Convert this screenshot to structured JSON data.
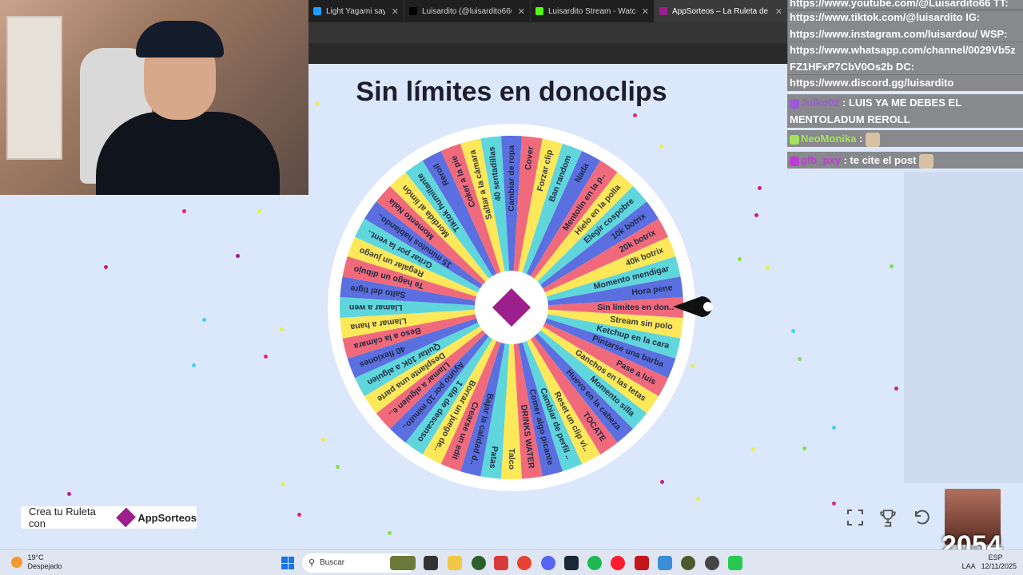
{
  "tabs": [
    {
      "label": "Light Yagami saying",
      "fav": "#1e9fff",
      "active": false
    },
    {
      "label": "Luisardito (@luisardito666) / X",
      "fav": "#000000",
      "active": false
    },
    {
      "label": "Luisardito Stream - Watch Live",
      "fav": "#53fc18",
      "active": false
    },
    {
      "label": "AppSorteos – La Ruleta de",
      "fav": "#9c1f8d",
      "active": true
    }
  ],
  "page": {
    "title": "Sin límites en donoclips",
    "brand_prefix": "Crea tu Ruleta con",
    "brand_name": "AppSorteos"
  },
  "wheel": {
    "colors": [
      "#f06a7c",
      "#fde85a",
      "#5fd6dc",
      "#5b6fe0"
    ],
    "segments": [
      "Sin límites en don..",
      "Stream sin polo",
      "Ketchup en la cara",
      "Pintarse una barba",
      "Pase a luis",
      "Ganchos en las tetas",
      "Momento silla",
      "Huevo en la cabeza",
      "TOCATE",
      "Reset un clip vi..",
      "Cambiar de perfil ..",
      "Comer algo picante",
      "DRINKS WATER",
      "Talco",
      "Patas",
      "Bajar la calidad d..",
      "Crearse un edit",
      "Borrar un juego de..",
      "1 día de descanso",
      "Ayuno por 10 minuto..",
      "Llamar a alguien e..",
      "Desplante una parte",
      "Quitar 10K a alguien",
      "40 flexiones",
      "Beso a la cámara",
      "Llamar a hana",
      "Llamar a wen",
      "Salto del tigre",
      "Te hago un dibujo",
      "Regalar un juego",
      "Gritar por la vent..",
      "15 minutos hablando..",
      "Momento Nala",
      "Mordida al limón",
      "Tiktok humillante",
      "Reroll",
      "Coker a la pie",
      "Saltar a la cámara",
      "40 sentadillas",
      "Cambiar de ropa",
      "Cover",
      "Forzar clip",
      "Ban random",
      "Nada",
      "Mentolin en la p..",
      "Hielo en la polla",
      "Elegir cospobre",
      "10k botrix",
      "20k botrix",
      "40k botrix",
      "Momento mendigar",
      "Hora pene"
    ]
  },
  "chat": [
    {
      "text": "https://www.youtube.com/@Luisardito66 TT:"
    },
    {
      "text": "https://www.tiktok.com/@luisardito IG:"
    },
    {
      "text": "https://www.instagram.com/luisardou/ WSP:"
    },
    {
      "text": "https://www.whatsapp.com/channel/0029Vb5z"
    },
    {
      "text": "FZ1HFxP7CbV0Os2b DC:"
    },
    {
      "text": "https://www.discord.gg/luisardito"
    },
    {
      "user": "Juiko02",
      "user_color": "#9b59d6",
      "msg": ": LUIS YA ME DEBES EL"
    },
    {
      "text": "MENTOLADUM REROLL"
    },
    {
      "user": "NeoMonika",
      "user_color": "#a5e35b",
      "msg": ":"
    },
    {
      "user": "gfb_pxy",
      "user_color": "#c03bd6",
      "msg": ": te cite el post"
    }
  ],
  "overlay_number": "2054",
  "taskbar": {
    "weather_temp": "19°C",
    "weather_desc": "Despejado",
    "search_placeholder": "Buscar",
    "lang": "ESP",
    "lang2": "LAA",
    "date": "12/11/2025"
  }
}
